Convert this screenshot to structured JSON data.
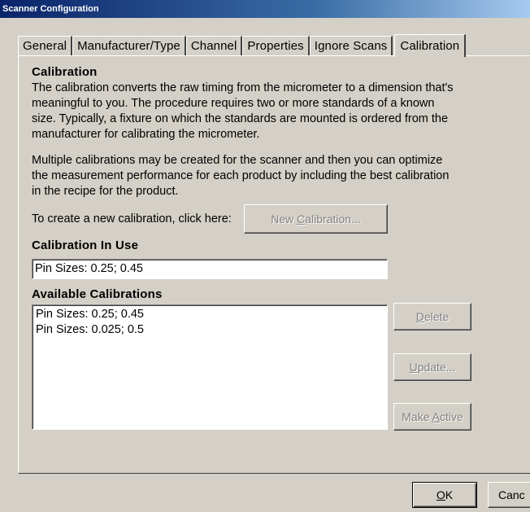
{
  "window": {
    "title": "Scanner Configuration"
  },
  "tabs": [
    {
      "label": "General"
    },
    {
      "label": "Manufacturer/Type"
    },
    {
      "label": "Channel"
    },
    {
      "label": "Properties"
    },
    {
      "label": "Ignore Scans"
    },
    {
      "label": "Calibration"
    }
  ],
  "active_tab": "Calibration",
  "calibration": {
    "heading": "Calibration",
    "paragraph1": "The calibration converts the raw timing from the micrometer to a dimension that's meaningful to you.  The procedure requires two or more standards of a known size.  Typically, a fixture on which the standards are mounted is ordered from the manufacturer for calibrating the micrometer.",
    "paragraph2": "Multiple calibrations may be created for the scanner and then you can optimize the measurement performance for each product by including the best calibration in the recipe for the product.",
    "create_label": "To create a new calibration, click here:",
    "new_button": {
      "pre": "New ",
      "key": "C",
      "post": "alibration..."
    }
  },
  "in_use": {
    "heading": "Calibration In Use",
    "value": "Pin Sizes: 0.25; 0.45"
  },
  "available": {
    "heading": "Available Calibrations",
    "items": [
      "Pin Sizes: 0.25; 0.45",
      "Pin Sizes: 0.025; 0.5"
    ],
    "delete_button": {
      "pre": "",
      "key": "D",
      "post": "elete"
    },
    "update_button": {
      "pre": "",
      "key": "U",
      "post": "pdate..."
    },
    "make_active_button": {
      "pre": "Make ",
      "key": "A",
      "post": "ctive"
    }
  },
  "footer": {
    "ok_button": {
      "pre": "",
      "key": "O",
      "post": "K"
    },
    "cancel_button": {
      "label": "Canc"
    }
  }
}
